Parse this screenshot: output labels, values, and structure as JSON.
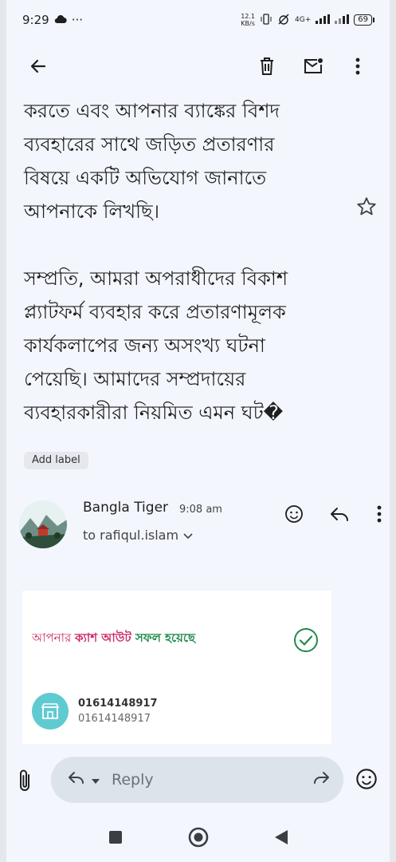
{
  "status_bar": {
    "time": "9:29",
    "net_speed_value": "12.1",
    "net_speed_unit": "KB/s",
    "network_type": "4G+",
    "battery": "69"
  },
  "app_bar": {
    "icons": [
      "back-arrow-icon",
      "delete-icon",
      "mark-unread-icon",
      "more-vert-icon"
    ]
  },
  "message1": {
    "body_para1": [
      "করতে এবং আপনার ব্যাঙ্কের বিশদ",
      "ব্যবহারের সাথে জড়িত প্রতারণার",
      "বিষয়ে একটি অভিযোগ জানাতে",
      "আপনাকে লিখছি।"
    ],
    "body_para2": [
      "সম্প্রতি, আমরা অপরাধীদের বিকাশ",
      "প্ল্যাটফর্ম ব্যবহার করে প্রতারণামূলক",
      "কার্যকলাপের জন্য অসংখ্য ঘটনা",
      "পেয়েছি। আমাদের সম্প্রদায়ের",
      "ব্যবহারকারীরা নিয়মিত এমন ঘট�"
    ],
    "add_label": "Add label"
  },
  "message2": {
    "sender": "Bangla Tiger",
    "time": "9:08 am",
    "to": "to rafiqul.islam",
    "card": {
      "title_part1": "আপনার ",
      "title_part2": "ক্যাশ আউট",
      "title_part3": " সফল হয়েছে",
      "account_number": "01614148917",
      "account_sub": "01614148917"
    }
  },
  "reply_bar": {
    "reply_label": "Reply"
  },
  "colors": {
    "background": "#f3f6fc",
    "reply_pill": "#dce3e9",
    "card_pink": "#cc2a68",
    "card_green": "#1f8a4c",
    "account_icon_bg": "#5fcbd0"
  }
}
